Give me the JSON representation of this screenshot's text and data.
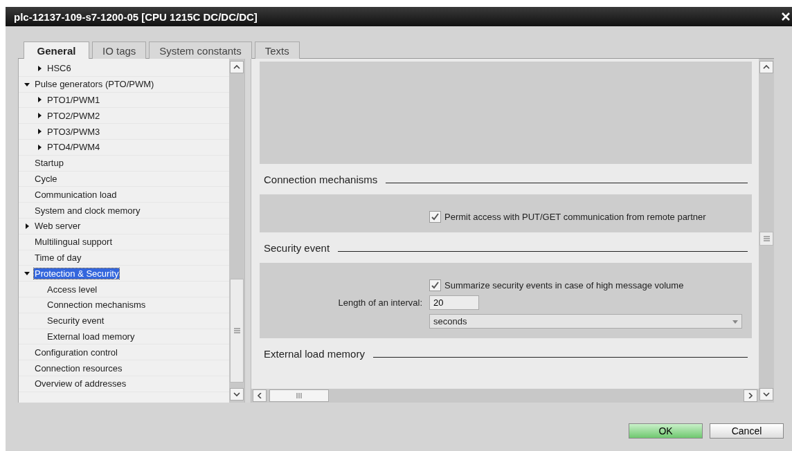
{
  "window": {
    "title": "plc-12137-109-s7-1200-05 [CPU 1215C DC/DC/DC]"
  },
  "tabs": [
    {
      "label": "General",
      "selected": true
    },
    {
      "label": "IO tags",
      "selected": false
    },
    {
      "label": "System constants",
      "selected": false
    },
    {
      "label": "Texts",
      "selected": false
    }
  ],
  "tree": [
    {
      "children": [
        {
          "label": "HSC6",
          "expanded": false,
          "has_children": true,
          "selected": false
        }
      ]
    },
    {
      "label": "Pulse generators (PTO/PWM)",
      "expanded": true,
      "has_children": true,
      "selected": false,
      "children": [
        {
          "label": "PTO1/PWM1",
          "expanded": false,
          "has_children": true,
          "selected": false
        },
        {
          "label": "PTO2/PWM2",
          "expanded": false,
          "has_children": true,
          "selected": false
        },
        {
          "label": "PTO3/PWM3",
          "expanded": false,
          "has_children": true,
          "selected": false
        },
        {
          "label": "PTO4/PWM4",
          "expanded": false,
          "has_children": true,
          "selected": false
        }
      ]
    },
    {
      "label": "Startup",
      "has_children": false,
      "selected": false
    },
    {
      "label": "Cycle",
      "has_children": false,
      "selected": false
    },
    {
      "label": "Communication load",
      "has_children": false,
      "selected": false
    },
    {
      "label": "System and clock memory",
      "has_children": false,
      "selected": false
    },
    {
      "label": "Web server",
      "expanded": false,
      "has_children": true,
      "selected": false
    },
    {
      "label": "Multilingual support",
      "has_children": false,
      "selected": false
    },
    {
      "label": "Time of day",
      "has_children": false,
      "selected": false
    },
    {
      "label": "Protection & Security",
      "expanded": true,
      "has_children": true,
      "selected": true,
      "children": [
        {
          "label": "Access level",
          "has_children": false,
          "selected": false
        },
        {
          "label": "Connection mechanisms",
          "has_children": false,
          "selected": false
        },
        {
          "label": "Security event",
          "has_children": false,
          "selected": false
        },
        {
          "label": "External load memory",
          "has_children": false,
          "selected": false
        }
      ]
    },
    {
      "label": "Configuration control",
      "has_children": false,
      "selected": false
    },
    {
      "label": "Connection resources",
      "has_children": false,
      "selected": false
    },
    {
      "label": "Overview of addresses",
      "has_children": false,
      "selected": false
    }
  ],
  "sections": [
    {
      "title": "Connection mechanisms",
      "checkbox": {
        "label": "Permit access with PUT/GET communication from remote partner",
        "checked": true
      }
    },
    {
      "title": "Security event",
      "checkbox": {
        "label": "Summarize security events in case of high message volume",
        "checked": true
      },
      "interval": {
        "label": "Length of an interval:",
        "value": "20",
        "unit": "seconds"
      }
    },
    {
      "title": "External load memory"
    }
  ],
  "buttons": [
    {
      "label": "OK",
      "kind": "primary"
    },
    {
      "label": "Cancel",
      "kind": "secondary"
    }
  ]
}
